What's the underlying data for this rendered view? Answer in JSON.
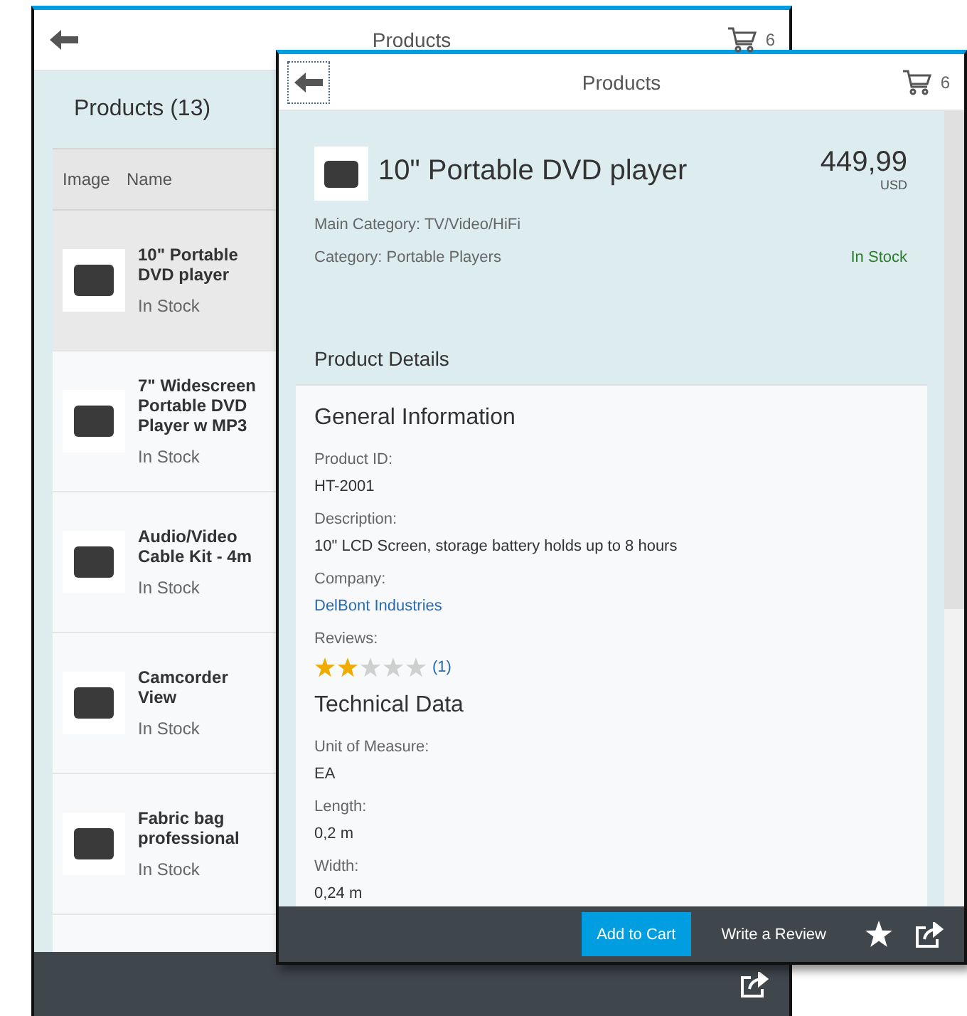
{
  "list_window": {
    "header": {
      "title": "Products",
      "cart_count": "6"
    },
    "list_title": "Products (13)",
    "columns": [
      "Image",
      "Name"
    ],
    "rows": [
      {
        "name": "10\" Portable DVD player",
        "status": "In Stock",
        "selected": true
      },
      {
        "name": "7\" Widescreen Portable DVD Player w MP3",
        "status": "In Stock",
        "selected": false
      },
      {
        "name": "Audio/Video Cable Kit - 4m",
        "status": "In Stock",
        "selected": false
      },
      {
        "name": "Camcorder View",
        "status": "In Stock",
        "selected": false
      },
      {
        "name": "Fabric bag professional",
        "status": "In Stock",
        "selected": false
      }
    ]
  },
  "detail_window": {
    "header": {
      "title": "Products",
      "cart_count": "6"
    },
    "product": {
      "title": "10\" Portable DVD player",
      "price": "449,99",
      "currency": "USD",
      "main_category": "Main Category: TV/Video/HiFi",
      "category": "Category: Portable Players",
      "availability": "In Stock"
    },
    "section_title": "Product Details",
    "groups": [
      {
        "title": "General Information",
        "fields": [
          {
            "kind": "text",
            "label": "Product ID:",
            "value": "HT-2001"
          },
          {
            "kind": "text",
            "label": "Description:",
            "value": "10\" LCD Screen, storage battery holds up to 8 hours"
          },
          {
            "kind": "link",
            "label": "Company:",
            "value": "DelBont Industries"
          },
          {
            "kind": "rating",
            "label": "Reviews:",
            "stars": 2,
            "value": "(1)"
          }
        ]
      },
      {
        "title": "Technical Data",
        "fields": [
          {
            "kind": "text",
            "label": "Unit of Measure:",
            "value": "EA"
          },
          {
            "kind": "text",
            "label": "Length:",
            "value": "0,2 m"
          },
          {
            "kind": "text",
            "label": "Width:",
            "value": "0,24 m"
          }
        ]
      }
    ],
    "footer": {
      "buttons": [
        {
          "kind": "primary",
          "label": "Add to Cart"
        },
        {
          "kind": "plain",
          "label": "Write a Review"
        }
      ]
    }
  }
}
